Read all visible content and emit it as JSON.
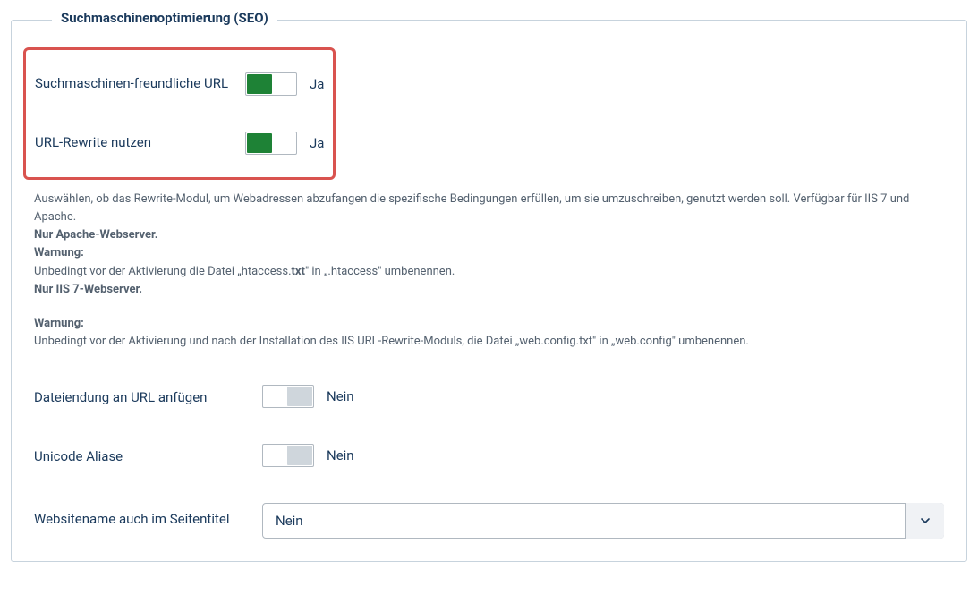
{
  "legend": "Suchmaschinenoptimierung (SEO)",
  "sef_url": {
    "label": "Suchmaschinen-freundliche URL",
    "state": "Ja"
  },
  "url_rewrite": {
    "label": "URL-Rewrite nutzen",
    "state": "Ja"
  },
  "desc": {
    "line1": "Auswählen, ob das Rewrite-Modul, um Webadressen abzufangen die spezifische Bedingungen erfüllen, um sie umzuschreiben, genutzt werden soll. Verfügbar für IIS 7 und Apache.",
    "apache_only": "Nur Apache-Webserver.",
    "warning_label": "Warnung:",
    "apache_warn_a": "Unbedingt vor der Aktivierung die Datei „htaccess.",
    "apache_warn_b": "txt",
    "apache_warn_c": "\" in „.htaccess\" umbenennen.",
    "iis_only": "Nur IIS 7-Webserver.",
    "iis_warn": "Unbedingt vor der Aktivierung und nach der Installation des IIS URL-Rewrite-Moduls, die Datei „web.config.txt\" in „web.config\" umbenennen."
  },
  "file_suffix": {
    "label": "Dateiendung an URL anfügen",
    "state": "Nein"
  },
  "unicode_alias": {
    "label": "Unicode Aliase",
    "state": "Nein"
  },
  "site_name_title": {
    "label": "Websitename auch im Seitentitel",
    "value": "Nein"
  }
}
